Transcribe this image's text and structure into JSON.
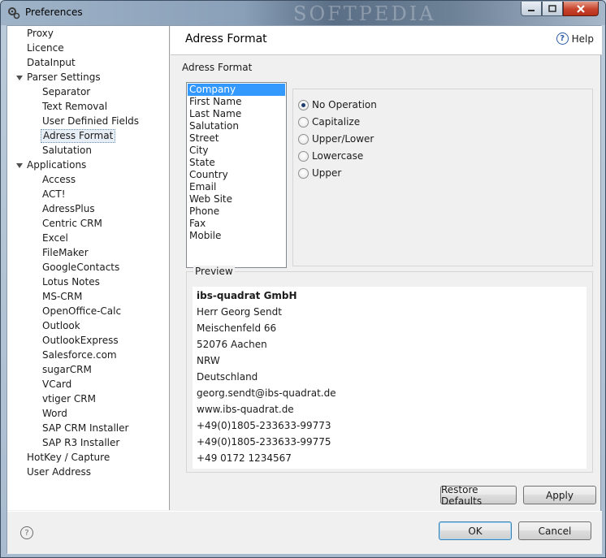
{
  "window": {
    "title": "Preferences",
    "watermark": "SOFTPEDIA"
  },
  "nav": {
    "items": [
      {
        "label": "Proxy",
        "level": 0,
        "expander": false
      },
      {
        "label": "Licence",
        "level": 0,
        "expander": false
      },
      {
        "label": "DataInput",
        "level": 0,
        "expander": false
      },
      {
        "label": "Parser Settings",
        "level": 0,
        "expander": true
      },
      {
        "label": "Separator",
        "level": 1,
        "expander": false
      },
      {
        "label": "Text Removal",
        "level": 1,
        "expander": false
      },
      {
        "label": "User Definied Fields",
        "level": 1,
        "expander": false
      },
      {
        "label": "Adress Format",
        "level": 1,
        "expander": false,
        "selected": true
      },
      {
        "label": "Salutation",
        "level": 1,
        "expander": false
      },
      {
        "label": "Applications",
        "level": 0,
        "expander": true
      },
      {
        "label": "Access",
        "level": 1,
        "expander": false
      },
      {
        "label": "ACT!",
        "level": 1,
        "expander": false
      },
      {
        "label": "AdressPlus",
        "level": 1,
        "expander": false
      },
      {
        "label": "Centric CRM",
        "level": 1,
        "expander": false
      },
      {
        "label": "Excel",
        "level": 1,
        "expander": false
      },
      {
        "label": "FileMaker",
        "level": 1,
        "expander": false
      },
      {
        "label": "GoogleContacts",
        "level": 1,
        "expander": false
      },
      {
        "label": "Lotus Notes",
        "level": 1,
        "expander": false
      },
      {
        "label": "MS-CRM",
        "level": 1,
        "expander": false
      },
      {
        "label": "OpenOffice-Calc",
        "level": 1,
        "expander": false
      },
      {
        "label": "Outlook",
        "level": 1,
        "expander": false
      },
      {
        "label": "OutlookExpress",
        "level": 1,
        "expander": false
      },
      {
        "label": "Salesforce.com",
        "level": 1,
        "expander": false
      },
      {
        "label": "sugarCRM",
        "level": 1,
        "expander": false
      },
      {
        "label": "VCard",
        "level": 1,
        "expander": false
      },
      {
        "label": "vtiger CRM",
        "level": 1,
        "expander": false
      },
      {
        "label": "Word",
        "level": 1,
        "expander": false
      },
      {
        "label": "SAP CRM Installer",
        "level": 1,
        "expander": false
      },
      {
        "label": "SAP R3 Installer",
        "level": 1,
        "expander": false
      },
      {
        "label": "HotKey / Capture",
        "level": 0,
        "expander": false
      },
      {
        "label": "User Address",
        "level": 0,
        "expander": false
      }
    ]
  },
  "header": {
    "title": "Adress Format",
    "help_label": "Help",
    "help_glyph": "?"
  },
  "section_label": "Adress Format",
  "fields": [
    "Company",
    "First Name",
    "Last Name",
    "Salutation",
    "Street",
    "City",
    "State",
    "Country",
    "Email",
    "Web Site",
    "Phone",
    "Fax",
    "Mobile"
  ],
  "selected_field": "Company",
  "operations": [
    {
      "label": "No Operation",
      "checked": true
    },
    {
      "label": "Capitalize",
      "checked": false
    },
    {
      "label": "Upper/Lower",
      "checked": false
    },
    {
      "label": "Lowercase",
      "checked": false
    },
    {
      "label": "Upper",
      "checked": false
    }
  ],
  "preview": {
    "label": "Preview",
    "lines": [
      "ibs-quadrat GmbH",
      "Herr Georg Sendt",
      "Meischenfeld 66",
      "52076 Aachen",
      "NRW",
      "Deutschland",
      "georg.sendt@ibs-quadrat.de",
      "www.ibs-quadrat.de",
      "+49(0)1805-233633-99773",
      "+49(0)1805-233633-99775",
      "+49 0172 1234567"
    ]
  },
  "buttons": {
    "restore_defaults": "Restore Defaults",
    "apply": "Apply",
    "ok": "OK",
    "cancel": "Cancel"
  },
  "footer": {
    "help_glyph": "?"
  },
  "icons": {
    "app": "gears-icon",
    "help": "help-circle-icon"
  },
  "colors": {
    "selection": "#3399ff",
    "help_blue": "#2a5da8",
    "close_red": "#c7432b"
  }
}
